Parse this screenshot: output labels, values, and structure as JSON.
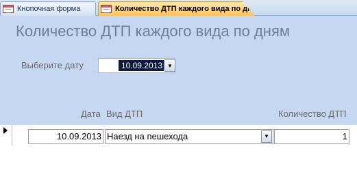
{
  "tabs": [
    {
      "label": "Кнопочная форма"
    },
    {
      "label": "Количество ДТП каждого вида по дням"
    }
  ],
  "header": {
    "title": "Количество ДТП каждого вида по дням",
    "date_filter": {
      "label": "Выберите дату",
      "value": "10.09.2013"
    },
    "columns": {
      "date": "Дата",
      "type": "Вид ДТП",
      "count": "Количество ДТП"
    }
  },
  "rows": [
    {
      "date": "10.09.2013",
      "type": "Наезд на пешехода",
      "count": "1"
    }
  ],
  "icons": {
    "tab_form": "form-icon",
    "dropdown": "chevron-down-icon",
    "record_pointer": "current-record-icon"
  },
  "colors": {
    "header_bg": "#c6d8f1",
    "active_tab": "#ffc35a",
    "title_text": "#6e7e99"
  }
}
